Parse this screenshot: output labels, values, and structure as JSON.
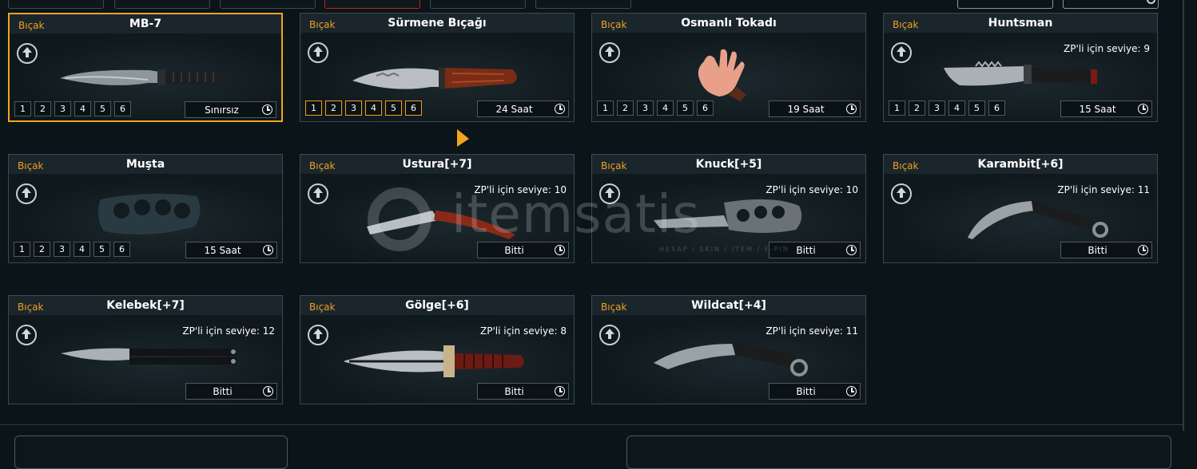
{
  "watermark": {
    "brand": "itemsatis",
    "tagline": "HESAP / SKIN / ITEM / E-PIN"
  },
  "cards": [
    {
      "category": "Bıçak",
      "name": "MB-7",
      "duration": "Sınırsız",
      "levels": [
        "1",
        "2",
        "3",
        "4",
        "5",
        "6"
      ],
      "selected": true
    },
    {
      "category": "Bıçak",
      "name": "Sürmene Bıçağı",
      "duration": "24 Saat",
      "levels": [
        "1",
        "2",
        "3",
        "4",
        "5",
        "6"
      ]
    },
    {
      "category": "Bıçak",
      "name": "Osmanlı Tokadı",
      "duration": "19 Saat",
      "levels": [
        "1",
        "2",
        "3",
        "4",
        "5",
        "6"
      ]
    },
    {
      "category": "Bıçak",
      "name": "Huntsman",
      "zp_level": "ZP'li için seviye: 9",
      "duration": "15 Saat",
      "levels": [
        "1",
        "2",
        "3",
        "4",
        "5",
        "6"
      ]
    },
    {
      "category": "Bıçak",
      "name": "Muşta",
      "duration": "15 Saat",
      "levels": [
        "1",
        "2",
        "3",
        "4",
        "5",
        "6"
      ]
    },
    {
      "category": "Bıçak",
      "name": "Ustura[+7]",
      "zp_level": "ZP'li için seviye: 10",
      "duration": "Bitti"
    },
    {
      "category": "Bıçak",
      "name": "Knuck[+5]",
      "zp_level": "ZP'li için seviye: 10",
      "duration": "Bitti"
    },
    {
      "category": "Bıçak",
      "name": "Karambit[+6]",
      "zp_level": "ZP'li için seviye: 11",
      "duration": "Bitti"
    },
    {
      "category": "Bıçak",
      "name": "Kelebek[+7]",
      "zp_level": "ZP'li için seviye: 12",
      "duration": "Bitti"
    },
    {
      "category": "Bıçak",
      "name": "Gölge[+6]",
      "zp_level": "ZP'li için seviye: 8",
      "duration": "Bitti"
    },
    {
      "category": "Bıçak",
      "name": "Wildcat[+4]",
      "zp_level": "ZP'li için seviye: 11",
      "duration": "Bitti"
    }
  ],
  "colors": {
    "accent": "#f0a020",
    "background": "#0b1418",
    "card_border": "#3a4a52",
    "active_tab": "#c2231f"
  }
}
